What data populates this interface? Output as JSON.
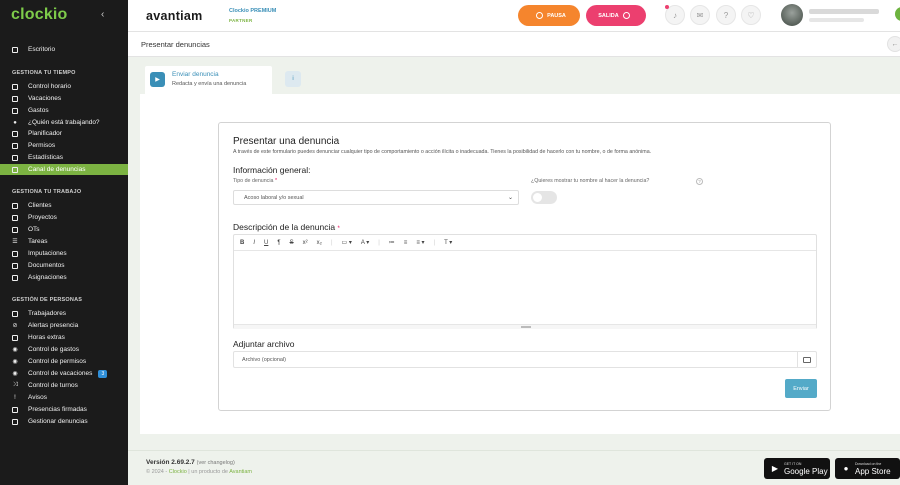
{
  "sidebar": {
    "logo": "clockio",
    "collapse_icon": "chevron-left-icon",
    "sections": [
      {
        "title": ""
      },
      {
        "title": "GESTIONA TU TIEMPO"
      },
      {
        "title": "GESTIONA TU TRABAJO"
      },
      {
        "title": "GESTIÓN DE PERSONAS"
      }
    ],
    "items": [
      {
        "label": "Escritorio",
        "icon": "desktop-icon"
      },
      {
        "label": "Control horario",
        "icon": "clock-icon"
      },
      {
        "label": "Vacaciones",
        "icon": "calendar-icon"
      },
      {
        "label": "Gastos",
        "icon": "wallet-icon"
      },
      {
        "label": "¿Quién está trabajando?",
        "icon": "people-icon"
      },
      {
        "label": "Planificador",
        "icon": "planner-icon"
      },
      {
        "label": "Permisos",
        "icon": "permission-icon"
      },
      {
        "label": "Estadísticas",
        "icon": "stats-icon"
      },
      {
        "label": "Canal de denuncias",
        "icon": "report-icon"
      },
      {
        "label": "Clientes",
        "icon": "clients-icon"
      },
      {
        "label": "Proyectos",
        "icon": "folder-icon"
      },
      {
        "label": "OTs",
        "icon": "tag-icon"
      },
      {
        "label": "Tareas",
        "icon": "tasks-icon"
      },
      {
        "label": "Imputaciones",
        "icon": "clipboard-icon"
      },
      {
        "label": "Documentos",
        "icon": "document-icon"
      },
      {
        "label": "Asignaciones",
        "icon": "assign-icon"
      },
      {
        "label": "Trabajadores",
        "icon": "workers-icon"
      },
      {
        "label": "Alertas presencia",
        "icon": "alert-icon"
      },
      {
        "label": "Horas extras",
        "icon": "overtime-icon"
      },
      {
        "label": "Control de gastos",
        "icon": "expense-control-icon"
      },
      {
        "label": "Control de permisos",
        "icon": "permission-control-icon"
      },
      {
        "label": "Control de vacaciones",
        "icon": "vacation-control-icon",
        "badge": "3"
      },
      {
        "label": "Control de turnos",
        "icon": "shuffle-icon"
      },
      {
        "label": "Avisos",
        "icon": "notice-icon"
      },
      {
        "label": "Presencias firmadas",
        "icon": "signature-icon"
      },
      {
        "label": "Gestionar denuncias",
        "icon": "manage-reports-icon"
      }
    ]
  },
  "header": {
    "brand": "avantiam",
    "partner_line1": "Clockio PREMIUM",
    "partner_line2": "PARTNER",
    "pausa": "PAUSA",
    "salida": "SALIDA",
    "icons": [
      "bell-icon",
      "mail-icon",
      "help-icon",
      "heart-icon"
    ]
  },
  "page": {
    "title": "Presentar denuncias"
  },
  "tabs": {
    "active_title": "Enviar denuncia",
    "active_subtitle": "Redacta y envía una denuncia"
  },
  "form": {
    "title": "Presentar una denuncia",
    "description": "A través de este formulario puedes denunciar cualquier tipo de comportamiento o acción ilícita o inadecuada. Tienes la posibilidad de hacerlo con tu nombre, o de forma anónima.",
    "general_heading": "Información general:",
    "type_label": "Tipo de denuncia",
    "type_value": "Acoso laboral y/o sexual",
    "show_name_label": "¿Quieres mostrar tu nombre al hacer la denuncia?",
    "description_heading": "Descripción de la denuncia",
    "required_mark": "*",
    "attach_heading": "Adjuntar archivo",
    "attach_placeholder": "Archivo (opcional)",
    "submit": "Enviar",
    "toolbar": [
      "B",
      "I",
      "U",
      "¶",
      "S",
      "x²",
      "x₂",
      "▭ ▾",
      "A ▾",
      "≔",
      "≡",
      "≡ ▾",
      "T ▾"
    ]
  },
  "footer": {
    "version": "Versión 2.69.2.7",
    "changelog": "(ver changelog)",
    "copyright_prefix": "© 2024 -",
    "copyright_brand": "Clockio",
    "copyright_mid": "| un producto de",
    "copyright_company": "Avantiam",
    "google_small": "GET IT ON",
    "google_big": "Google Play",
    "apple_small": "Download on the",
    "apple_big": "App Store"
  }
}
